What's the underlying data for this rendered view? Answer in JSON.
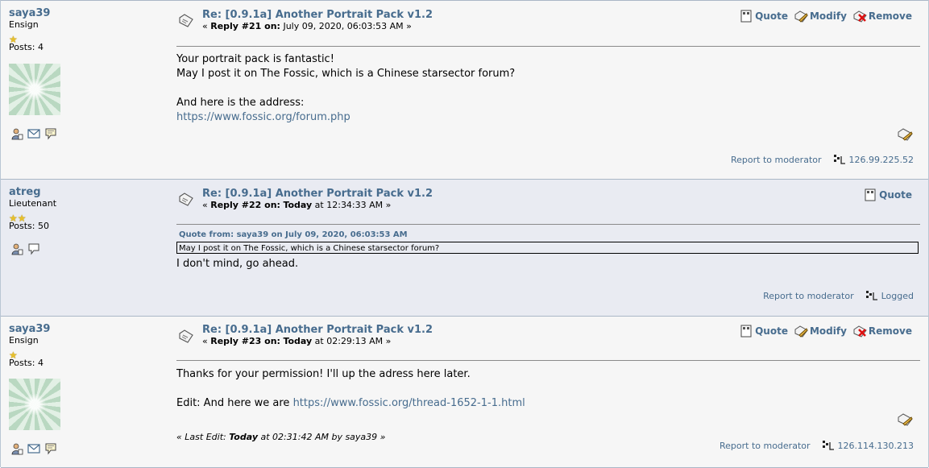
{
  "posts": [
    {
      "poster": {
        "name": "saya39",
        "rank": "Ensign",
        "stars": "★",
        "posts": "Posts: 4"
      },
      "subject": "Re: [0.9.1a] Another Portrait Pack v1.2",
      "reply": {
        "open": "« ",
        "label": "Reply #21 on:",
        "date_bold": "",
        "date": " July 09, 2020, 06:03:53 AM",
        "close": " »"
      },
      "actions": {
        "quote": "Quote",
        "modify": "Modify",
        "remove": "Remove"
      },
      "body": {
        "line1": "Your portrait pack is fantastic!",
        "line2": "May I post it on The Fossic, which is a Chinese starsector forum?",
        "line3": "And here is the address:",
        "link": "https://www.fossic.org/forum.php"
      },
      "footer": {
        "report": "Report to moderator",
        "ip": "126.99.225.52"
      }
    },
    {
      "poster": {
        "name": "atreg",
        "rank": "Lieutenant",
        "stars": "★★",
        "posts": "Posts: 50"
      },
      "subject": "Re: [0.9.1a] Another Portrait Pack v1.2",
      "reply": {
        "open": "« ",
        "label": "Reply #22 on:",
        "date_bold": "Today",
        "date": " at 12:34:33 AM",
        "close": " »"
      },
      "actions": {
        "quote": "Quote"
      },
      "quote": {
        "header": "Quote from: saya39 on July 09, 2020, 06:03:53 AM",
        "text": "May I post it on The Fossic, which is a Chinese starsector forum?"
      },
      "body": {
        "line1": "I don't mind, go ahead."
      },
      "footer": {
        "report": "Report to moderator",
        "ip": "Logged"
      }
    },
    {
      "poster": {
        "name": "saya39",
        "rank": "Ensign",
        "stars": "★",
        "posts": "Posts: 4"
      },
      "subject": "Re: [0.9.1a] Another Portrait Pack v1.2",
      "reply": {
        "open": "« ",
        "label": "Reply #23 on:",
        "date_bold": "Today",
        "date": " at 02:29:13 AM",
        "close": " »"
      },
      "actions": {
        "quote": "Quote",
        "modify": "Modify",
        "remove": "Remove"
      },
      "body": {
        "line1": "Thanks for your permission! I'll up the adress here later.",
        "line2": "Edit: And here we are ",
        "link": "https://www.fossic.org/thread-1652-1-1.html"
      },
      "edit": {
        "open": "« ",
        "label": "Last Edit:",
        "date_bold": "Today",
        "rest": " at 02:31:42 AM by saya39",
        "close": " »"
      },
      "footer": {
        "report": "Report to moderator",
        "ip": "126.114.130.213"
      }
    }
  ],
  "colors": {
    "link": "#476c8e",
    "alt1": "#f6f6f6",
    "alt2": "#e9ebf2",
    "star": "#e8c02a"
  },
  "icons": [
    "profile-icon",
    "email-icon",
    "pm-icon",
    "post-topic-icon",
    "quote-icon",
    "modify-icon",
    "remove-icon",
    "ip-icon"
  ]
}
